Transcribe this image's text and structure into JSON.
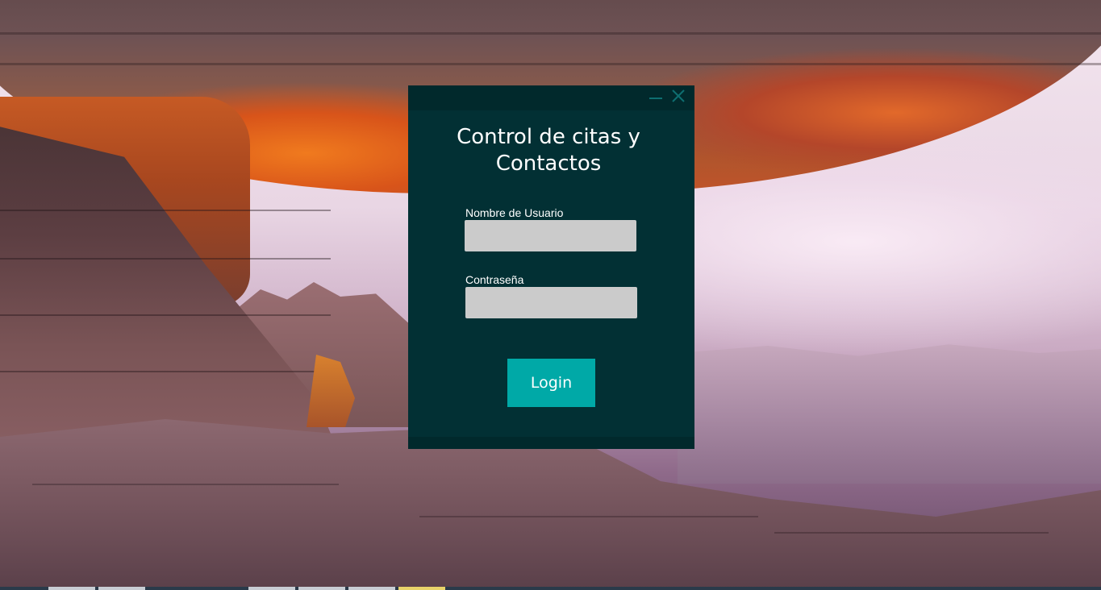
{
  "window": {
    "title": "Control de citas y\nContactos",
    "controls": {
      "minimize_icon": "minimize-icon",
      "close_icon": "close-icon"
    }
  },
  "form": {
    "username_label": "Nombre de Usuario",
    "username_value": "",
    "password_label": "Contraseña",
    "password_value": "",
    "login_label": "Login"
  },
  "colors": {
    "dialog_bg": "#023034",
    "titlebar_bg": "#01292c",
    "input_bg": "#cbcbcb",
    "accent": "#00a9a7",
    "control_icon": "#0e6e70"
  }
}
